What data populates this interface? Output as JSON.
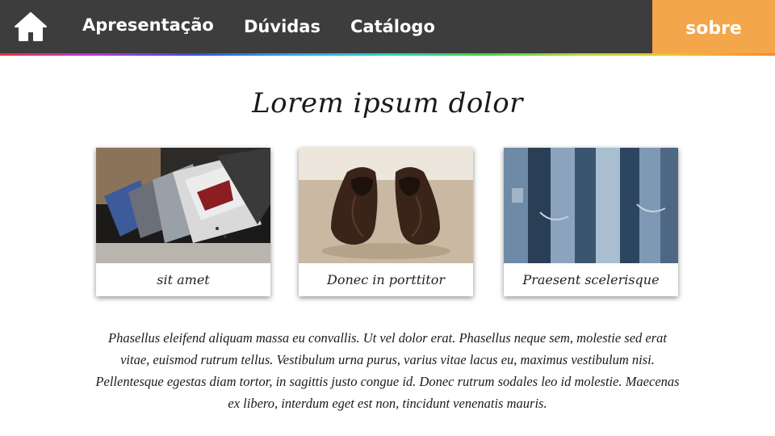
{
  "nav": {
    "home_icon": "home-icon",
    "items": [
      {
        "label": "Apresentação"
      },
      {
        "label": "Dúvidas"
      },
      {
        "label": "Catálogo"
      }
    ],
    "sobre_label": "sobre",
    "colors": {
      "bar": "#3d3d3d",
      "sobre": "#f3a64a",
      "text": "#ffffff"
    }
  },
  "main": {
    "title": "Lorem ipsum dolor",
    "cards": [
      {
        "caption": "sit amet",
        "image": "shirts-photo"
      },
      {
        "caption": "Donec in porttitor",
        "image": "shoes-photo"
      },
      {
        "caption": "Praesent scelerisque",
        "image": "jeans-photo"
      }
    ],
    "paragraph": "Phasellus eleifend aliquam massa eu convallis. Ut vel dolor erat. Phasellus neque sem, molestie sed erat vitae, euismod rutrum tellus. Vestibulum urna purus, varius vitae lacus eu, maximus vestibulum nisi. Pellentesque egestas diam tortor, in sagittis justo congue id. Donec rutrum sodales leo id molestie. Maecenas ex libero, interdum eget est non, tincidunt venenatis mauris."
  }
}
